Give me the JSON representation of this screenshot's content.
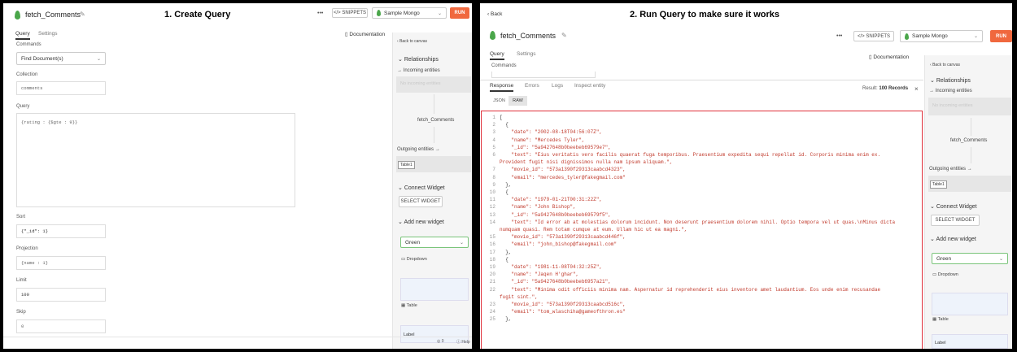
{
  "left": {
    "step_title": "1. Create Query",
    "query_name": "fetch_Comments",
    "more_label": "•••",
    "snippets_label": "</> SNIPPETS",
    "datasource": "Sample Mongo",
    "run_label": "RUN",
    "tabs": [
      "Query",
      "Settings"
    ],
    "documentation_label": "Documentation",
    "commands_label": "Commands",
    "command_value": "Find Document(s)",
    "collection_label": "Collection",
    "collection_value": "comments",
    "query_label": "Query",
    "query_value": "{rating : {$gte : 9}}",
    "sort_label": "Sort",
    "sort_value": "{\"_id\": 1}",
    "projection_label": "Projection",
    "projection_value": "{name : 1}",
    "limit_label": "Limit",
    "limit_value": "100",
    "skip_label": "Skip",
    "skip_value": "0",
    "sidebar": {
      "back": "Back to canvas",
      "relationships": "Relationships",
      "incoming": "Incoming entities",
      "incoming_empty": "No incoming entities",
      "node": "fetch_Comments",
      "outgoing": "Outgoing entities",
      "outgoing_chip": "Table1",
      "connect_widget": "Connect Widget",
      "select_widget": "SELECT WIDGET",
      "add_widget": "Add new widget",
      "green": "Green",
      "dropdown": "Dropdown",
      "table": "Table",
      "label": "Label",
      "footer_count": "0",
      "footer_help": "Help"
    }
  },
  "right": {
    "step_title": "2. Run Query to make sure it works",
    "back": "Back",
    "query_name": "fetch_Comments",
    "more_label": "•••",
    "snippets_label": "</> SNIPPETS",
    "datasource": "Sample Mongo",
    "run_label": "RUN",
    "tabs": [
      "Query",
      "Settings"
    ],
    "documentation_label": "Documentation",
    "commands_label": "Commands",
    "response_tabs": [
      "Response",
      "Errors",
      "Logs",
      "Inspect entity"
    ],
    "result_prefix": "Result:",
    "result_value": "100 Records",
    "view_tabs": [
      "JSON",
      "RAW"
    ],
    "code": [
      {
        "n": "1",
        "t": "["
      },
      {
        "n": "2",
        "t": "  {"
      },
      {
        "n": "3",
        "t": "    \"date\": \"2002-08-18T04:56:07Z\","
      },
      {
        "n": "4",
        "t": "    \"name\": \"Mercedes Tyler\","
      },
      {
        "n": "5",
        "t": "    \"_id\": \"5a9427648b0beebeb69579e7\","
      },
      {
        "n": "6",
        "t": "    \"text\": \"Eius veritatis vero facilis quaerat fuga temporibus. Praesentium expedita sequi repellat id. Corporis minima enim ex."
      },
      {
        "n": "",
        "t": "Provident fugit nisi dignissimos nulla nam ipsum aliquam.\","
      },
      {
        "n": "7",
        "t": "    \"movie_id\": \"573a1390f29313caabcd4323\","
      },
      {
        "n": "8",
        "t": "    \"email\": \"mercedes_tyler@fakegmail.com\""
      },
      {
        "n": "9",
        "t": "  },"
      },
      {
        "n": "10",
        "t": "  {"
      },
      {
        "n": "11",
        "t": "    \"date\": \"1979-01-21T00:31:22Z\","
      },
      {
        "n": "12",
        "t": "    \"name\": \"John Bishop\","
      },
      {
        "n": "13",
        "t": "    \"_id\": \"5a9427648b0beebeb69579f5\","
      },
      {
        "n": "14",
        "t": "    \"text\": \"Id error ab at molestias dolorum incidunt. Non deserunt praesentium dolorem nihil. Optio tempora vel ut quas.\\nMinus dicta"
      },
      {
        "n": "",
        "t": "numquam quasi. Rem totam cumque at eum. Ullam hic ut ea magni.\","
      },
      {
        "n": "15",
        "t": "    \"movie_id\": \"573a1390f29313caabcd446f\","
      },
      {
        "n": "16",
        "t": "    \"email\": \"john_bishop@fakegmail.com\""
      },
      {
        "n": "17",
        "t": "  },"
      },
      {
        "n": "18",
        "t": "  {"
      },
      {
        "n": "19",
        "t": "    \"date\": \"1981-11-08T04:32:25Z\","
      },
      {
        "n": "20",
        "t": "    \"name\": \"Jaqen H'ghar\","
      },
      {
        "n": "21",
        "t": "    \"_id\": \"5a9427648b0beebeb6957a21\","
      },
      {
        "n": "22",
        "t": "    \"text\": \"Minima odit officiis minima nam. Aspernatur id reprehenderit eius inventore amet laudantium. Eos unde enim recusandae"
      },
      {
        "n": "",
        "t": "fugit sint.\","
      },
      {
        "n": "23",
        "t": "    \"movie_id\": \"573a1390f29313caabcd516c\","
      },
      {
        "n": "24",
        "t": "    \"email\": \"tom_wlaschiha@gameofthron.es\""
      },
      {
        "n": "25",
        "t": "  },"
      }
    ],
    "sidebar": {
      "back": "Back to canvas",
      "relationships": "Relationships",
      "incoming": "Incoming entities",
      "incoming_empty": "No incoming entities",
      "node": "fetch_Comments",
      "outgoing": "Outgoing entities",
      "outgoing_chip": "Table1",
      "connect_widget": "Connect Widget",
      "select_widget": "SELECT WIDGET",
      "add_widget": "Add new widget",
      "green": "Green",
      "dropdown": "Dropdown",
      "table": "Table",
      "label": "Label"
    }
  },
  "colors": {
    "run": "#f0683e",
    "mongo_leaf": "#4aa64a",
    "highlight_border": "#e0303a",
    "string": "#c0392b"
  }
}
